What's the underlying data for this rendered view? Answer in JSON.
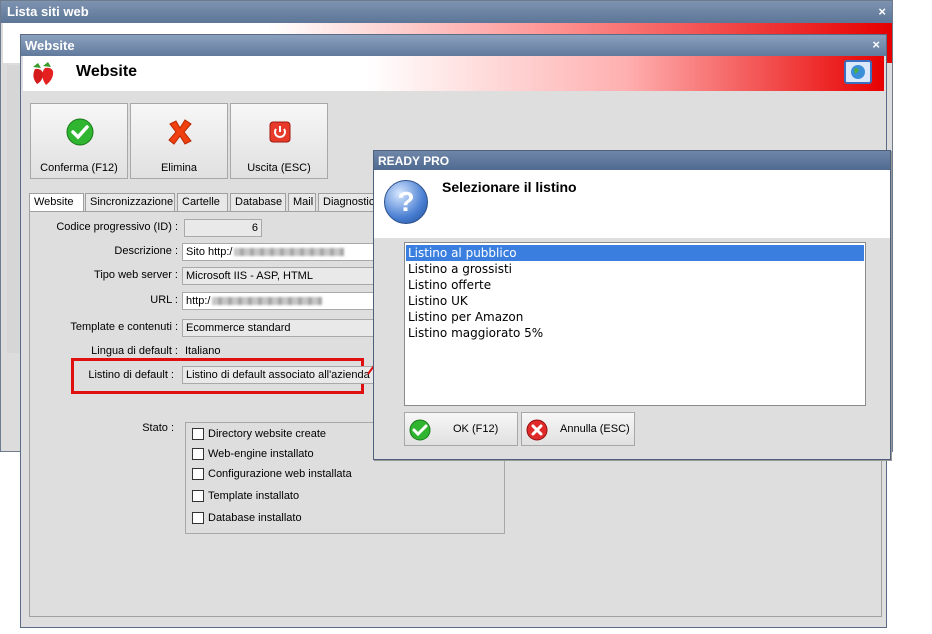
{
  "background_window": {
    "title": "Lista siti web",
    "close_glyph": "×"
  },
  "window": {
    "title": "Website",
    "banner_title": "Website",
    "close_glyph": "×",
    "toolbar": {
      "confirm_label": "Conferma (F12)",
      "delete_label": "Elimina",
      "exit_label": "Uscita (ESC)"
    },
    "tabs": [
      {
        "label": "Website",
        "active": true
      },
      {
        "label": "Sincronizzazione",
        "active": false
      },
      {
        "label": "Cartelle",
        "active": false
      },
      {
        "label": "Database",
        "active": false
      },
      {
        "label": "Mail",
        "active": false
      },
      {
        "label": "Diagnostic",
        "active": false
      }
    ],
    "fields": {
      "codice_label": "Codice progressivo (ID) :",
      "codice_value": "6",
      "descrizione_label": "Descrizione :",
      "descrizione_value": "Sito http:/",
      "tipo_label": "Tipo web server :",
      "tipo_value": "Microsoft IIS - ASP, HTML",
      "url_label": "URL :",
      "url_value": "http:/",
      "template_label": "Template e contenuti :",
      "template_value": "Ecommerce standard",
      "lingua_label": "Lingua di default :",
      "lingua_value": "Italiano",
      "listino_label": "Listino di default :",
      "listino_value": "Listino di default associato all'azienda"
    },
    "stato": {
      "label": "Stato :",
      "checkboxes": [
        {
          "label": "Directory website create",
          "checked": false
        },
        {
          "label": "Web-engine installato",
          "checked": false
        },
        {
          "label": "Configurazione web installata",
          "checked": false
        },
        {
          "label": "Template installato",
          "checked": false
        },
        {
          "label": "Database installato",
          "checked": false
        }
      ]
    }
  },
  "dialog": {
    "title": "READY PRO",
    "message": "Selezionare il listino",
    "items": [
      {
        "label": "Listino al pubblico",
        "selected": true
      },
      {
        "label": "Listino a grossisti",
        "selected": false
      },
      {
        "label": "Listino offerte",
        "selected": false
      },
      {
        "label": "Listino UK",
        "selected": false
      },
      {
        "label": "Listino per Amazon",
        "selected": false
      },
      {
        "label": "Listino maggiorato 5%",
        "selected": false
      }
    ],
    "ok_label": "OK (F12)",
    "cancel_label": "Annulla (ESC)"
  },
  "icons": {
    "confirm": "check-icon",
    "delete": "x-icon",
    "exit": "power-icon",
    "question": "question-icon",
    "logo": "strawberry-icon",
    "globe": "globe-icon"
  },
  "colors": {
    "annotation": "#e01010",
    "selection": "#3a7fe0",
    "title_bar": "#617a9c"
  }
}
